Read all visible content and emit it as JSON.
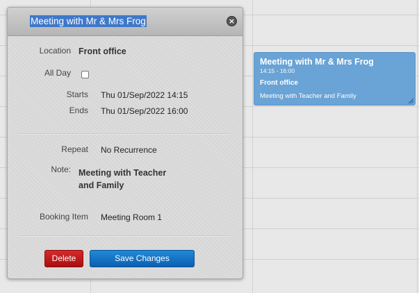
{
  "dialog": {
    "title": "Meeting with Mr & Mrs Frog",
    "close_icon": "close-icon",
    "fields": {
      "location_label": "Location",
      "location_value": "Front office",
      "all_day_label": "All Day",
      "all_day_checked": false,
      "starts_label": "Starts",
      "starts_value": "Thu 01/Sep/2022 14:15",
      "ends_label": "Ends",
      "ends_value": "Thu 01/Sep/2022 16:00",
      "repeat_label": "Repeat",
      "repeat_value": "No Recurrence",
      "note_label": "Note:",
      "note_line1": "Meeting with Teacher",
      "note_line2": "and Family",
      "booking_label": "Booking Item",
      "booking_value": "Meeting Room 1"
    },
    "buttons": {
      "delete": "Delete",
      "save": "Save Changes"
    }
  },
  "event": {
    "title": "Meeting with Mr & Mrs Frog",
    "time": "14:15 - 16:00",
    "location": "Front office",
    "note": "Meeting with Teacher and Family",
    "color": "#6aa3d5"
  }
}
